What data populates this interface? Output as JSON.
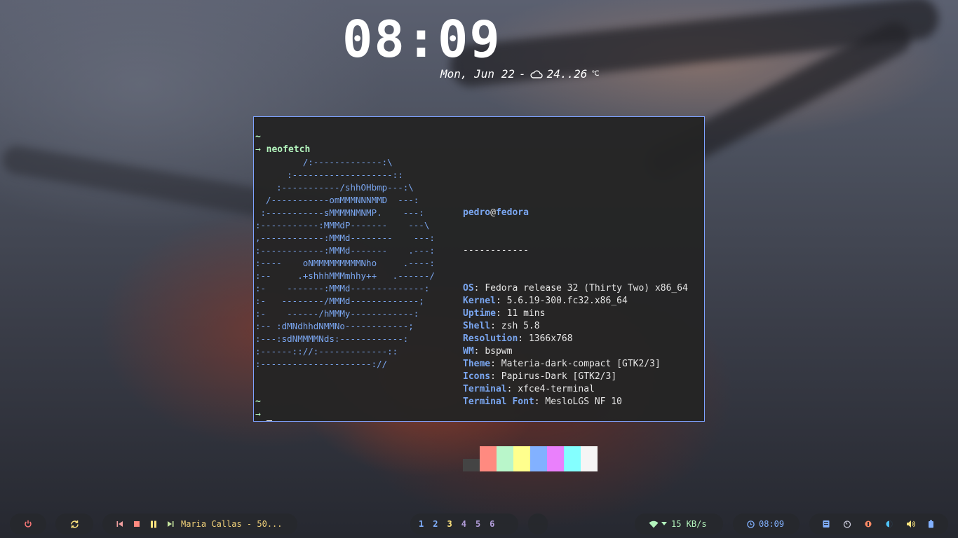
{
  "clock": {
    "time": "08:09"
  },
  "date_line": {
    "date": "Mon, Jun 22",
    "sep": "-",
    "weather_icon": "cloud-icon",
    "temp": "24..26",
    "unit": "℃"
  },
  "terminal": {
    "prompt_tilde": "~",
    "prompt_arrow": "→",
    "command": "neofetch",
    "logo_lines": [
      "         /:-------------:\\",
      "      :-------------------::",
      "    :-----------/shhOHbmp---:\\",
      "  /-----------omMMMNNNMMD  ---:",
      " :-----------sMMMMNMNMP.    ---:",
      ":-----------:MMMdP-------    ---\\",
      ",------------:MMMd--------    ---:",
      ":------------:MMMd-------    .---:",
      ":----    oNMMMMMMMMMNho     .----:",
      ":--     .+shhhMMMmhhy++   .------/",
      ":-    -------:MMMd--------------:",
      ":-   --------/MMMd-------------;",
      ":-    ------/hMMMy------------:",
      ":-- :dMNdhhdNMMNo------------;",
      ":---:sdNMMMMNds:------------:",
      ":------:://:-------------::",
      ":---------------------://"
    ],
    "user": "pedro",
    "at": "@",
    "host": "fedora",
    "divider": "------------",
    "info": [
      {
        "key": "OS",
        "value": "Fedora release 32 (Thirty Two) x86_64"
      },
      {
        "key": "Kernel",
        "value": "5.6.19-300.fc32.x86_64"
      },
      {
        "key": "Uptime",
        "value": "11 mins"
      },
      {
        "key": "Shell",
        "value": "zsh 5.8"
      },
      {
        "key": "Resolution",
        "value": "1366x768"
      },
      {
        "key": "WM",
        "value": "bspwm"
      },
      {
        "key": "Theme",
        "value": "Materia-dark-compact [GTK2/3]"
      },
      {
        "key": "Icons",
        "value": "Papirus-Dark [GTK2/3]"
      },
      {
        "key": "Terminal",
        "value": "xfce4-terminal"
      },
      {
        "key": "Terminal Font",
        "value": "MesloLGS NF 10"
      }
    ],
    "colors": [
      "#444444",
      "#ff8a80",
      "#b9f6ca",
      "#ffff8d",
      "#82b1ff",
      "#ea80fc",
      "#84ffff",
      "#f5f5f5"
    ],
    "border_color": "#7ea2ff"
  },
  "bar": {
    "power_icon": "power-icon",
    "refresh_icon": "refresh-icon",
    "media": {
      "prev_icon": "skip-previous-icon",
      "stop_icon": "stop-icon",
      "pause_icon": "pause-icon",
      "next_icon": "skip-next-icon",
      "title": "Maria Callas - 50..."
    },
    "workspaces": [
      {
        "label": "1",
        "color": "#82b1ff"
      },
      {
        "label": "2",
        "color": "#82b1ff"
      },
      {
        "label": "3",
        "color": "#ffe57f"
      },
      {
        "label": "4",
        "color": "#b39ddb"
      },
      {
        "label": "5",
        "color": "#b39ddb"
      },
      {
        "label": "6",
        "color": "#b39ddb"
      }
    ],
    "network": {
      "wifi_icon": "wifi-icon",
      "speed": "15 KB/s"
    },
    "clock": {
      "icon": "clock-icon",
      "time": "08:09"
    },
    "tray_icons": [
      "storage-icon",
      "timer-icon",
      "cpu-icon",
      "brightness-icon",
      "volume-icon",
      "battery-icon"
    ]
  }
}
